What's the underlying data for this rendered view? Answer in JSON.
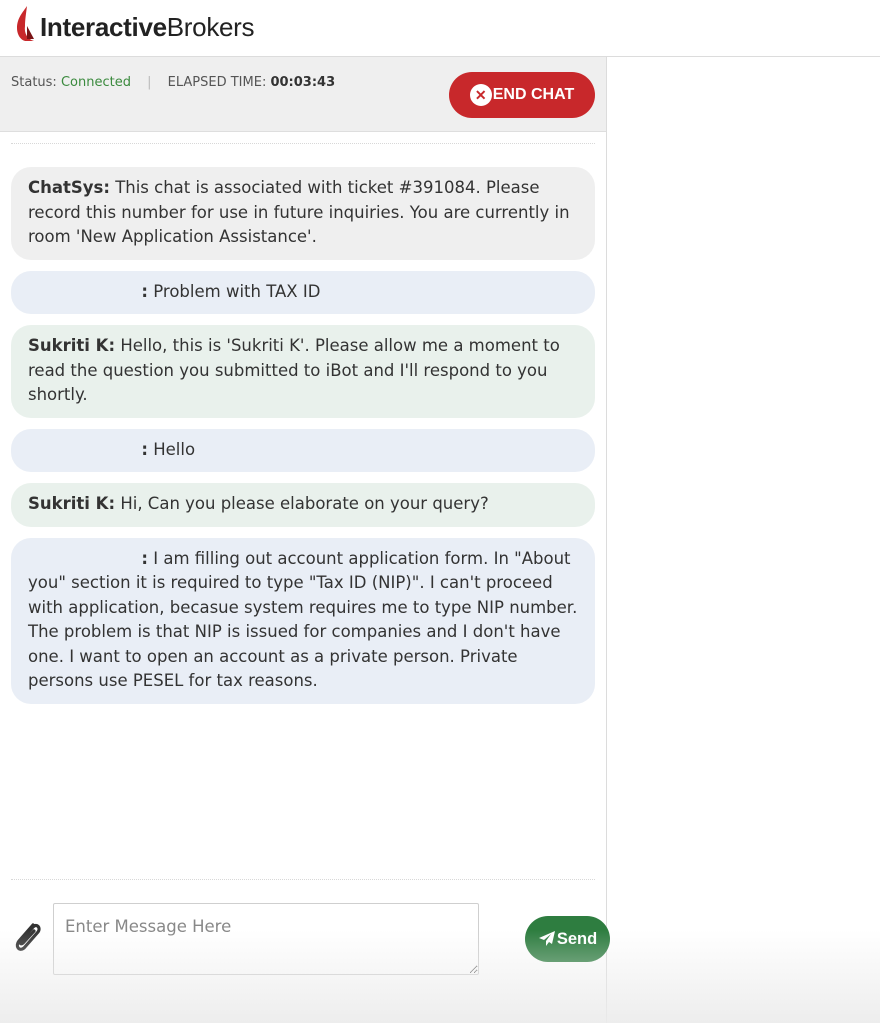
{
  "brand": {
    "logo_bold": "Interactive",
    "logo_regular": "Brokers"
  },
  "status": {
    "label": "Status:",
    "value": "Connected",
    "elapsed_label": "ELAPSED TIME:",
    "elapsed_value": "00:03:43"
  },
  "end_chat": {
    "label": "END CHAT",
    "icon": "close-circle-icon"
  },
  "messages": [
    {
      "type": "system",
      "author": "ChatSys:",
      "text": "This chat is associated with ticket #391084. Please record this number for use in future inquiries. You are currently in room 'New Application Assistance'."
    },
    {
      "type": "user",
      "author": ":",
      "text": "Problem with TAX ID"
    },
    {
      "type": "agent",
      "author": "Sukriti K:",
      "text": "Hello, this is 'Sukriti K'. Please allow me a moment to read the question you submitted to iBot and I'll respond to you shortly."
    },
    {
      "type": "user",
      "author": ":",
      "text": "Hello"
    },
    {
      "type": "agent",
      "author": "Sukriti K:",
      "text": "Hi, Can you please elaborate on your query?"
    },
    {
      "type": "user",
      "author": ":",
      "text": "I am filling out account application form. In \"About you\" section it is required to type \"Tax ID (NIP)\". I can't proceed with application, becasue system requires me to type NIP number. The problem is that NIP is issued for companies and I don't have one. I want to open an account as a private person. Private persons use PESEL for tax reasons."
    }
  ],
  "composer": {
    "placeholder": "Enter Message Here",
    "value": "",
    "attach_icon": "paperclip-icon",
    "send_label": "Send",
    "send_icon": "paper-plane-icon"
  },
  "colors": {
    "brand_red": "#c8282b",
    "connected_green": "#3b8a3e",
    "send_green": "#2e7d40",
    "system_bubble": "#efefef",
    "user_bubble": "#e9eef6",
    "agent_bubble": "#e9f1ec"
  }
}
